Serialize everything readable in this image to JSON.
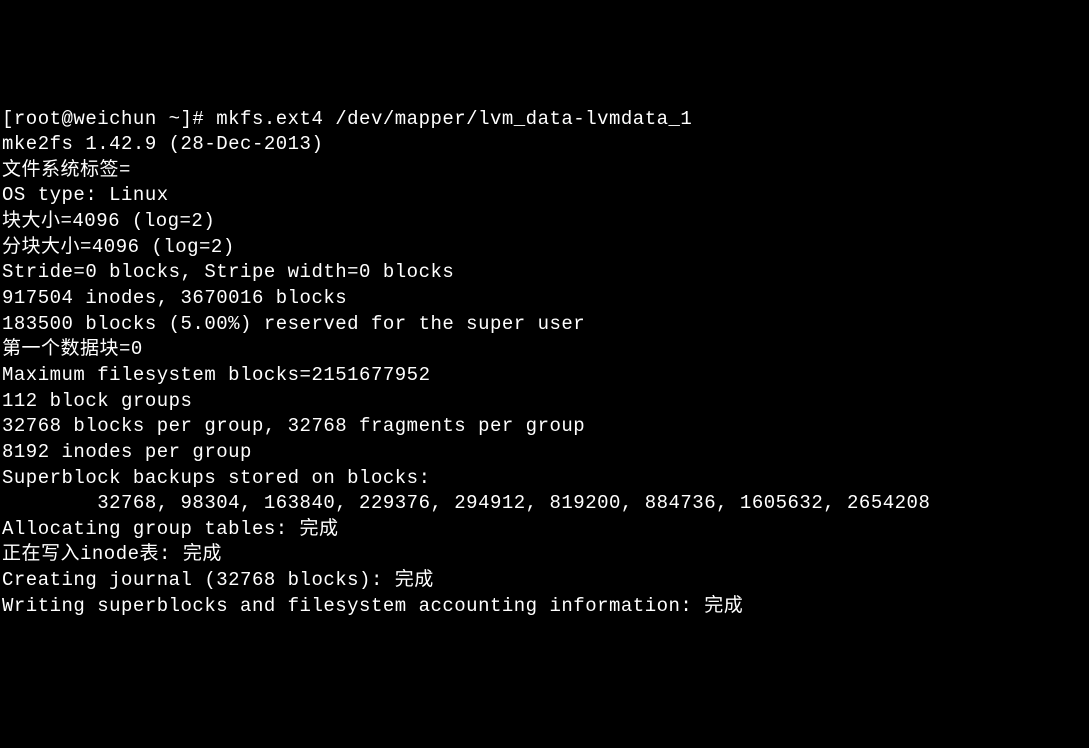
{
  "terminal": {
    "lines": {
      "l0_prompt": "[root@weichun ~]# ",
      "l0_cmd": "mkfs.ext4 /dev/mapper/lvm_data-lvmdata_1",
      "l1": "mke2fs 1.42.9 (28-Dec-2013)",
      "l2": "文件系统标签=",
      "l3": "OS type: Linux",
      "l4": "块大小=4096 (log=2)",
      "l5": "分块大小=4096 (log=2)",
      "l6": "Stride=0 blocks, Stripe width=0 blocks",
      "l7": "917504 inodes, 3670016 blocks",
      "l8": "183500 blocks (5.00%) reserved for the super user",
      "l9": "第一个数据块=0",
      "l10": "Maximum filesystem blocks=2151677952",
      "l11": "112 block groups",
      "l12": "32768 blocks per group, 32768 fragments per group",
      "l13": "8192 inodes per group",
      "l14": "Superblock backups stored on blocks: ",
      "l15": "        32768, 98304, 163840, 229376, 294912, 819200, 884736, 1605632, 2654208",
      "l16": "",
      "l17": "Allocating group tables: 完成                            ",
      "l18": "正在写入inode表: 完成                            ",
      "l19": "Creating journal (32768 blocks): 完成",
      "l20": "Writing superblocks and filesystem accounting information: 完成"
    }
  }
}
